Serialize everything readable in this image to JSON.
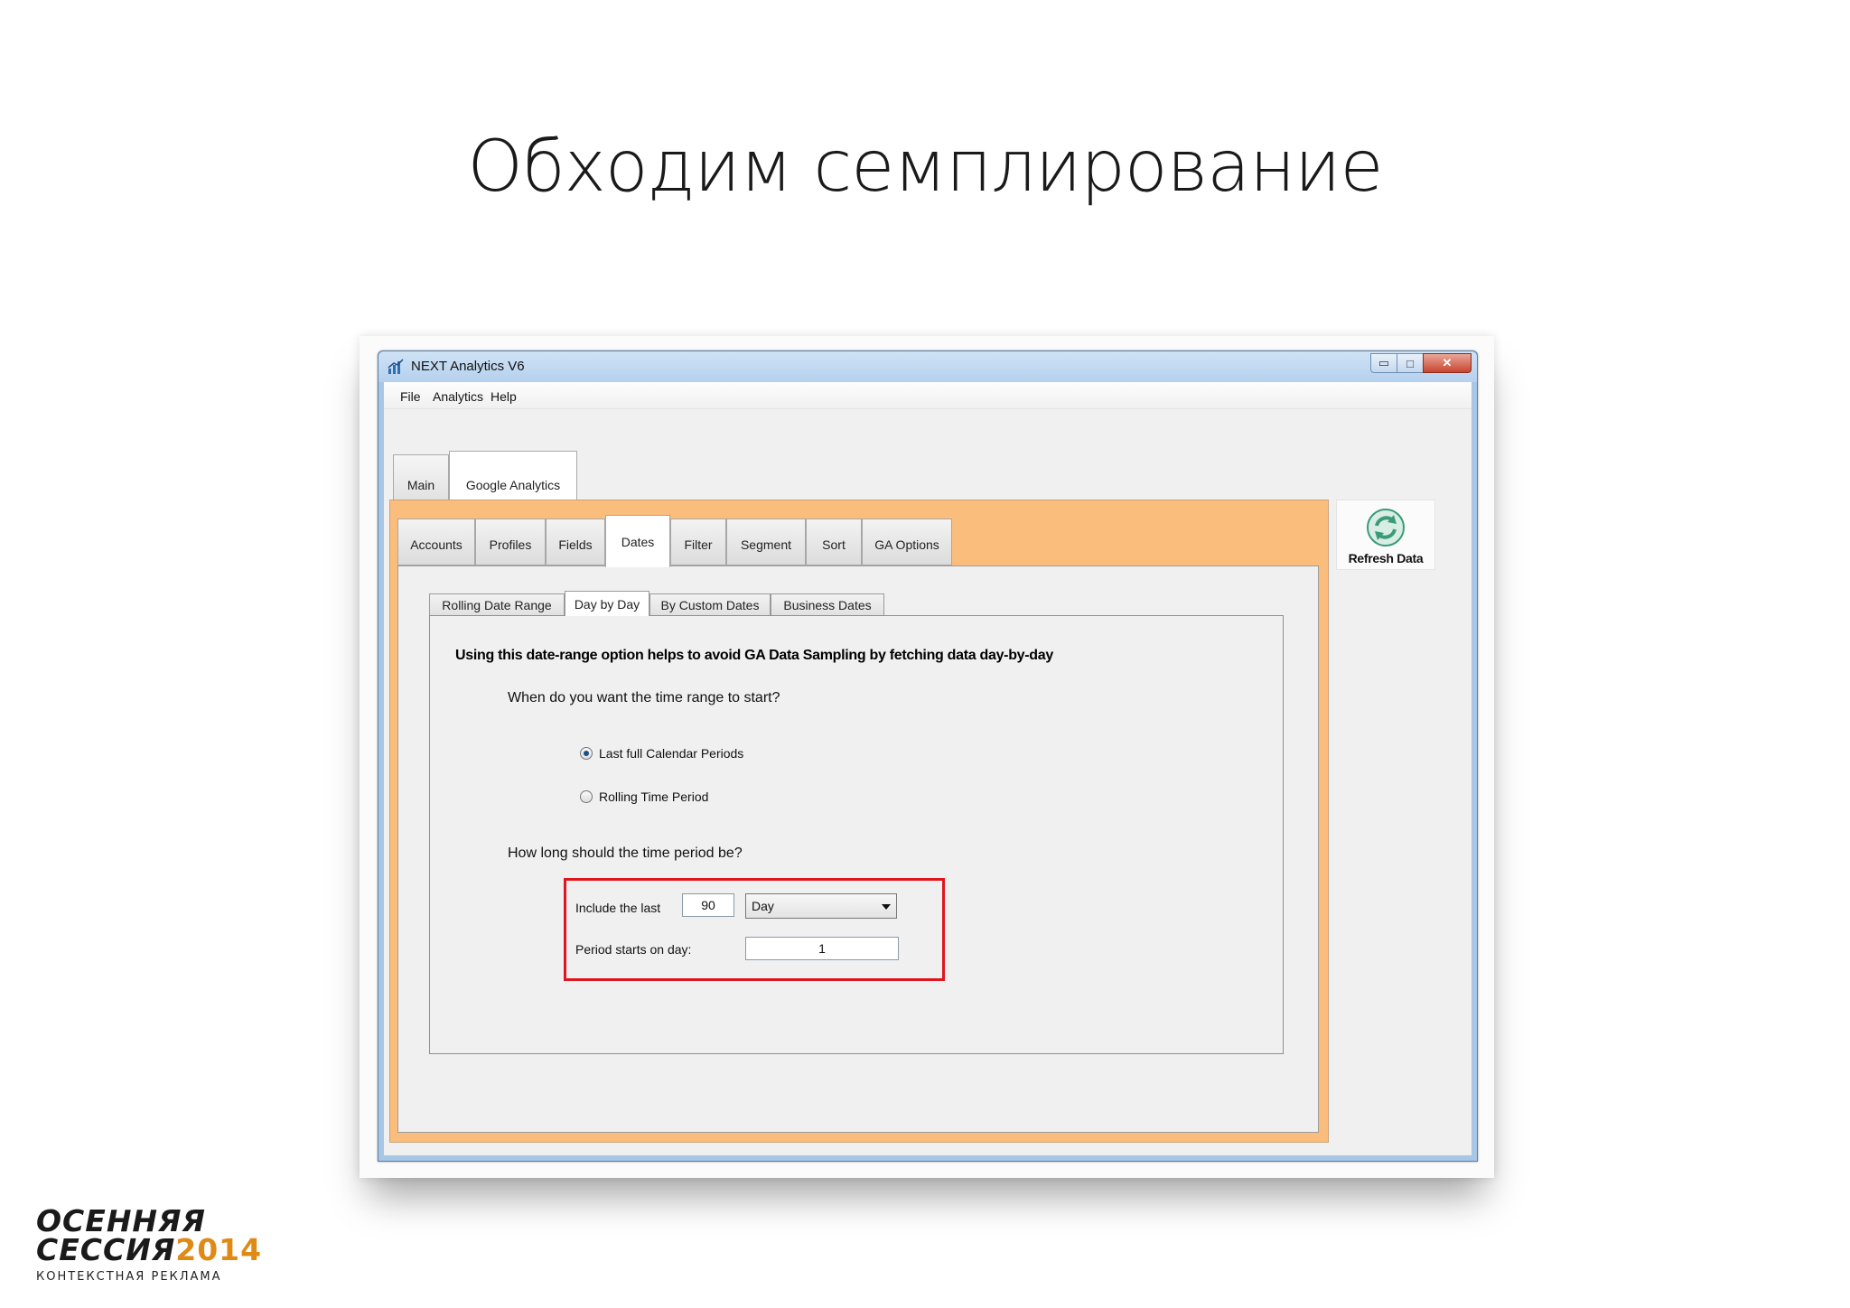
{
  "slide": {
    "title": "Обходим семплирование",
    "logo": {
      "line1": "ОСЕННЯЯ",
      "line2": "СЕССИЯ",
      "year": "2014",
      "subtitle": "КОНТЕКСТНАЯ РЕКЛАМА"
    }
  },
  "window": {
    "title": "NEXT Analytics V6",
    "controls": {
      "minimize": "▭",
      "maximize": "□",
      "close": "✕"
    }
  },
  "menu": {
    "items": [
      "File",
      "Analytics",
      "Help"
    ]
  },
  "top_tabs": [
    {
      "label": "Main",
      "active": false
    },
    {
      "label": "Google Analytics",
      "active": true
    }
  ],
  "sub_tabs": [
    {
      "label": "Accounts",
      "active": false
    },
    {
      "label": "Profiles",
      "active": false
    },
    {
      "label": "Fields",
      "active": false
    },
    {
      "label": "Dates",
      "active": true
    },
    {
      "label": "Filter",
      "active": false
    },
    {
      "label": "Segment",
      "active": false
    },
    {
      "label": "Sort",
      "active": false
    },
    {
      "label": "GA Options",
      "active": false
    }
  ],
  "date_tabs": [
    {
      "label": "Rolling Date Range",
      "active": false
    },
    {
      "label": "Day by Day",
      "active": true
    },
    {
      "label": "By Custom Dates",
      "active": false
    },
    {
      "label": "Business Dates",
      "active": false
    }
  ],
  "day_by_day": {
    "description": "Using this date-range option helps to avoid GA Data Sampling by fetching data day-by-day",
    "start_question": "When do you want the time range to start?",
    "options": [
      {
        "label": "Last full Calendar Periods",
        "selected": true
      },
      {
        "label": "Rolling Time Period",
        "selected": false
      }
    ],
    "length_question": "How long should the time period be?",
    "include_label": "Include the last",
    "include_value": "90",
    "unit_value": "Day",
    "period_start_label": "Period starts on day:",
    "period_start_value": "1"
  },
  "refresh": {
    "label": "Refresh Data"
  },
  "colors": {
    "accent_orange": "#fbbd7c",
    "highlight_red": "#e0151d",
    "refresh_green": "#3a9a7a"
  }
}
